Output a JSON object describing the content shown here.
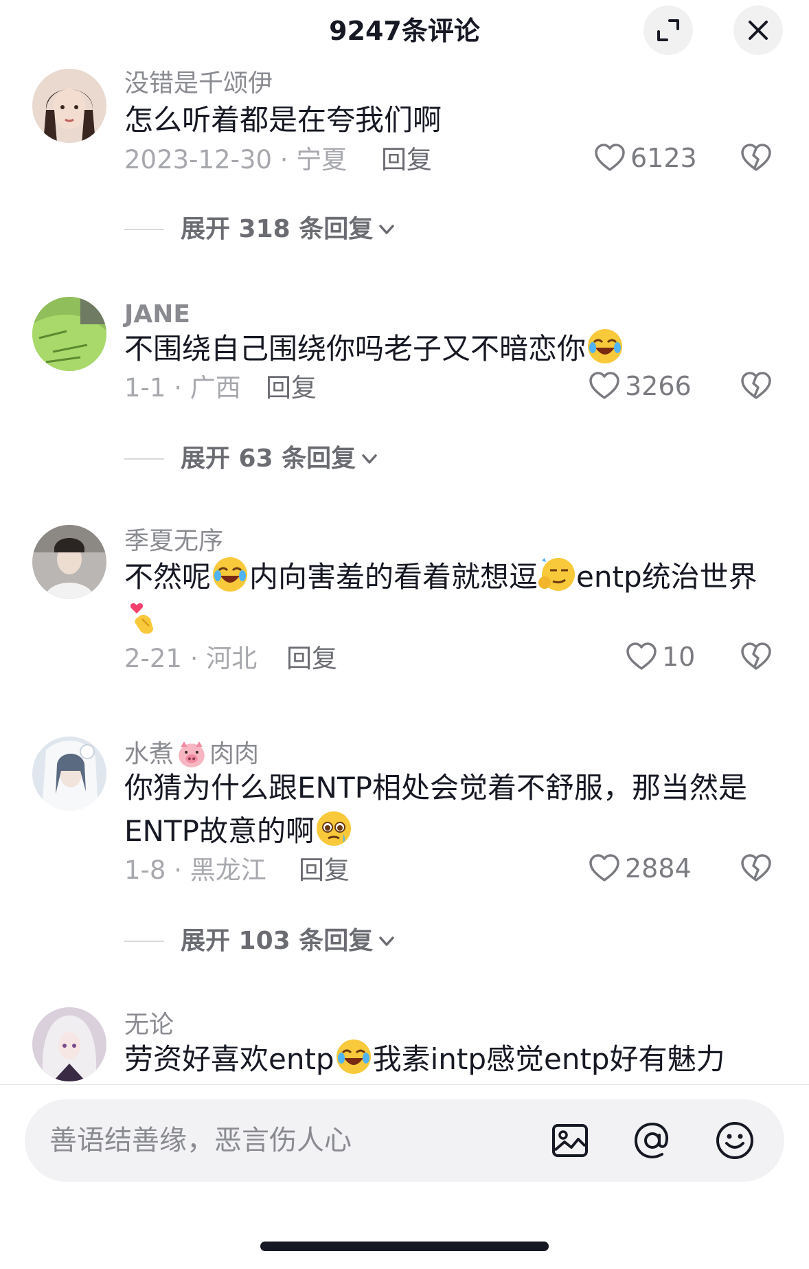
{
  "header": {
    "title": "9247条评论",
    "expand_icon": "expand-icon",
    "close_icon": "close-icon"
  },
  "comments": [
    {
      "username": "没错是千颂伊",
      "text": "怎么听着都是在夸我们啊",
      "date": "2023-12-30 · 宁夏",
      "reply_label": "回复",
      "likes": "6123",
      "expand_label": "展开 318 条回复"
    },
    {
      "username": "JANE",
      "text": "不围绕自己围绕你吗老子又不暗恋你",
      "emoji_after": "rofl",
      "date": "1-1 · 广西",
      "reply_label": "回复",
      "likes": "3266",
      "expand_label": "展开 63 条回复"
    },
    {
      "username": "季夏无序",
      "text_parts": [
        "不然呢",
        "内向害羞的看着就想逗",
        "entp统治世界"
      ],
      "emojis": [
        "laugh-cry",
        "smirk",
        "finger-heart"
      ],
      "date": "2-21 · 河北",
      "reply_label": "回复",
      "likes": "10"
    },
    {
      "username_part1": "水煮",
      "username_part2": "肉肉",
      "username_emoji": "pig-face",
      "text": "你猜为什么跟ENTP相处会觉着不舒服，那当然是ENTP故意的啊",
      "emoji_after": "pleading",
      "date": "1-8 · 黑龙江",
      "reply_label": "回复",
      "likes": "2884",
      "expand_label": "展开 103 条回复"
    },
    {
      "username": "无论",
      "text_parts": [
        "劳资好喜欢entp",
        "我素intp感觉entp好有魅力"
      ],
      "emojis": [
        "rofl"
      ]
    }
  ],
  "input": {
    "placeholder": "善语结善缘，恶言伤人心",
    "icons": [
      "image-icon",
      "at-icon",
      "emoji-icon"
    ]
  },
  "colors": {
    "text": "#161823",
    "secondary": "#8a8b91",
    "meta": "#a7a8ad",
    "input_bg": "#f2f2f4",
    "button_bg": "#f1f1f2"
  }
}
